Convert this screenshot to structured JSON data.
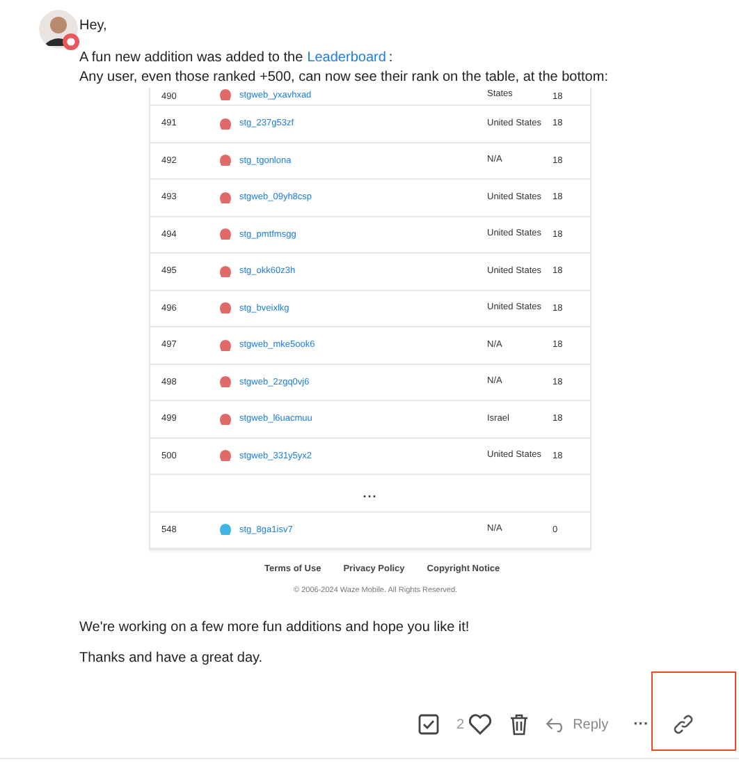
{
  "post": {
    "greeting": "Hey,",
    "intro": "A fun new addition was added to the",
    "link": "Leaderboard",
    "intro_end": ":",
    "line2": "Any user, even those ranked +500, can now see their rank on the table, at the bottom:"
  },
  "table": {
    "rows": [
      {
        "kind": "partial",
        "rank": "490",
        "user": "stgweb_yxavhxad",
        "country": "States",
        "score": "18",
        "color": "#e06a6a"
      },
      {
        "kind": "row",
        "rank": "491",
        "user": "stg_237g53zf",
        "country": "United States",
        "score": "18",
        "color": "#e06a6a"
      },
      {
        "kind": "row",
        "rank": "492",
        "user": "stg_tgonlona",
        "country": "N/A",
        "score": "18",
        "color": "#e06a6a"
      },
      {
        "kind": "row",
        "rank": "493",
        "user": "stgweb_09yh8csp",
        "country": "United States",
        "score": "18",
        "color": "#e06a6a"
      },
      {
        "kind": "row",
        "rank": "494",
        "user": "stg_pmtfmsgg",
        "country": "United States",
        "score": "18",
        "color": "#e06a6a"
      },
      {
        "kind": "row",
        "rank": "495",
        "user": "stg_okk60z3h",
        "country": "United States",
        "score": "18",
        "color": "#e06a6a"
      },
      {
        "kind": "row",
        "rank": "496",
        "user": "stg_bveixlkg",
        "country": "United States",
        "score": "18",
        "color": "#e06a6a"
      },
      {
        "kind": "row",
        "rank": "497",
        "user": "stgweb_mke5ook6",
        "country": "N/A",
        "score": "18",
        "color": "#e06a6a"
      },
      {
        "kind": "row",
        "rank": "498",
        "user": "stgweb_2zgq0vj6",
        "country": "N/A",
        "score": "18",
        "color": "#e06a6a"
      },
      {
        "kind": "row",
        "rank": "499",
        "user": "stgweb_l6uacmuu",
        "country": "Israel",
        "score": "18",
        "color": "#e06a6a"
      },
      {
        "kind": "row",
        "rank": "500",
        "user": "stgweb_331y5yx2",
        "country": "United States",
        "score": "18",
        "color": "#e06a6a"
      },
      {
        "kind": "gap",
        "text": "..."
      },
      {
        "kind": "row",
        "rank": "548",
        "user": "stg_8ga1isv7",
        "country": "N/A",
        "score": "0",
        "color": "#3fb5e0"
      }
    ],
    "footer_links": [
      "Terms of Use",
      "Privacy Policy",
      "Copyright Notice"
    ],
    "copyright": "© 2006-2024 Waze Mobile. All Rights Reserved."
  },
  "closing": [
    "We're working on a few more fun additions and hope you like it!",
    "Thanks and have a great day."
  ],
  "actions": {
    "solved": true,
    "like_count": "2",
    "reply": "Reply",
    "more": "···",
    "highlighted": true
  }
}
